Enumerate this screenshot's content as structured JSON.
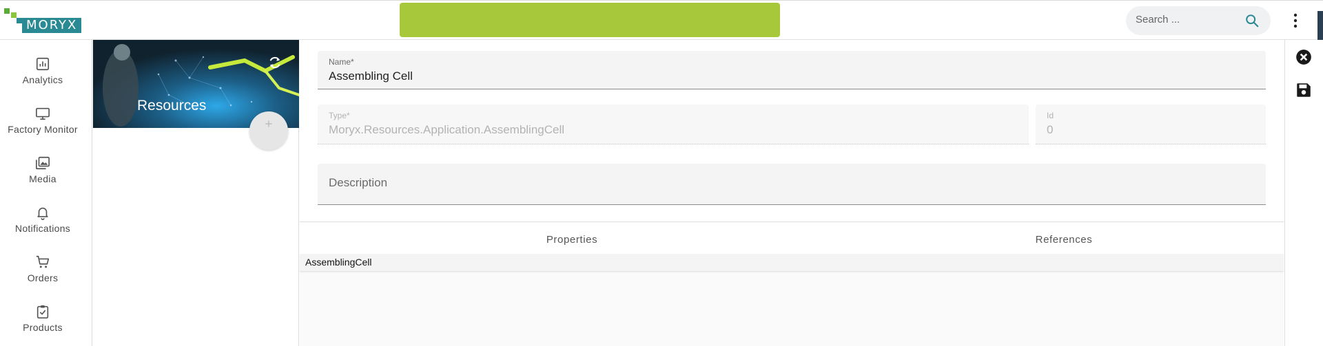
{
  "brand": {
    "logo_text": "MORYX"
  },
  "search": {
    "placeholder": "Search ..."
  },
  "sidebar": {
    "items": [
      {
        "label": "Analytics",
        "icon": "analytics-icon"
      },
      {
        "label": "Factory Monitor",
        "icon": "monitor-icon"
      },
      {
        "label": "Media",
        "icon": "media-icon"
      },
      {
        "label": "Notifications",
        "icon": "bell-icon"
      },
      {
        "label": "Orders",
        "icon": "cart-icon"
      },
      {
        "label": "Products",
        "icon": "clipboard-check-icon"
      }
    ]
  },
  "resources_panel": {
    "title": "Resources"
  },
  "form": {
    "name_label": "Name*",
    "name_value": "Assembling Cell",
    "type_label": "Type*",
    "type_value": "Moryx.Resources.Application.AssemblingCell",
    "id_label": "Id",
    "id_value": "0",
    "description_placeholder": "Description"
  },
  "tabs": [
    {
      "label": "Properties"
    },
    {
      "label": "References"
    }
  ],
  "grid": {
    "rows": [
      {
        "label": "AssemblingCell"
      }
    ]
  },
  "colors": {
    "banner": "#a8c83b",
    "brand_teal": "#2a8a93",
    "accent_dark": "#2a3f52"
  }
}
